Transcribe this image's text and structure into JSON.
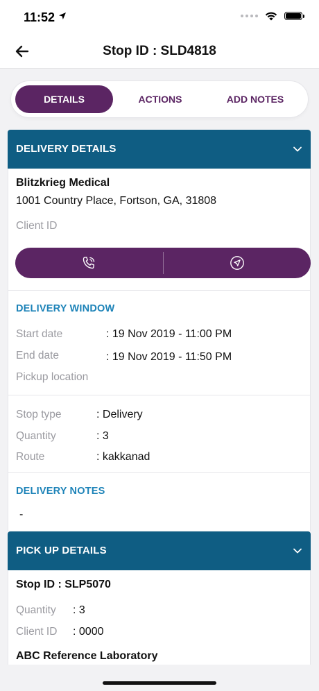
{
  "status_bar": {
    "time": "11:52",
    "icons": [
      "location-arrow-icon",
      "signal-dots-icon",
      "wifi-icon",
      "battery-icon"
    ]
  },
  "nav": {
    "title": "Stop ID : SLD4818",
    "back_icon": "arrow-left-icon"
  },
  "tabs": [
    {
      "label": "DETAILS",
      "active": true
    },
    {
      "label": "ACTIONS",
      "active": false
    },
    {
      "label": "ADD NOTES",
      "active": false
    }
  ],
  "delivery": {
    "header": "DELIVERY DETAILS",
    "client_name": "Blitzkrieg Medical",
    "address": "1001 Country Place, Fortson, GA, 31808",
    "client_id_label": "Client ID",
    "client_id_value": "",
    "call_icon": "phone-icon",
    "navigate_icon": "navigation-icon",
    "window": {
      "title": "DELIVERY WINDOW",
      "start_label": "Start date",
      "start_value": ": 19 Nov 2019 - 11:00 PM",
      "end_label": "End date",
      "end_value": ": 19 Nov 2019 - 11:50 PM",
      "pickup_label": "Pickup location",
      "pickup_value": ""
    },
    "info": {
      "stop_type_label": "Stop type",
      "stop_type_value": ": Delivery",
      "quantity_label": "Quantity",
      "quantity_value": ": 3",
      "route_label": "Route",
      "route_value": ": kakkanad"
    },
    "notes_title": "DELIVERY NOTES",
    "notes_value": "-"
  },
  "pickup": {
    "header": "PICK UP DETAILS",
    "stop_id": "Stop ID : SLP5070",
    "quantity_label": "Quantity",
    "quantity_value": ": 3",
    "client_id_label": "Client ID",
    "client_id_value": ": 0000",
    "lab_name": "ABC Reference Laboratory"
  },
  "colors": {
    "brand_purple": "#5b2563",
    "header_blue": "#0f5d83",
    "accent_blue": "#1d83b8"
  }
}
